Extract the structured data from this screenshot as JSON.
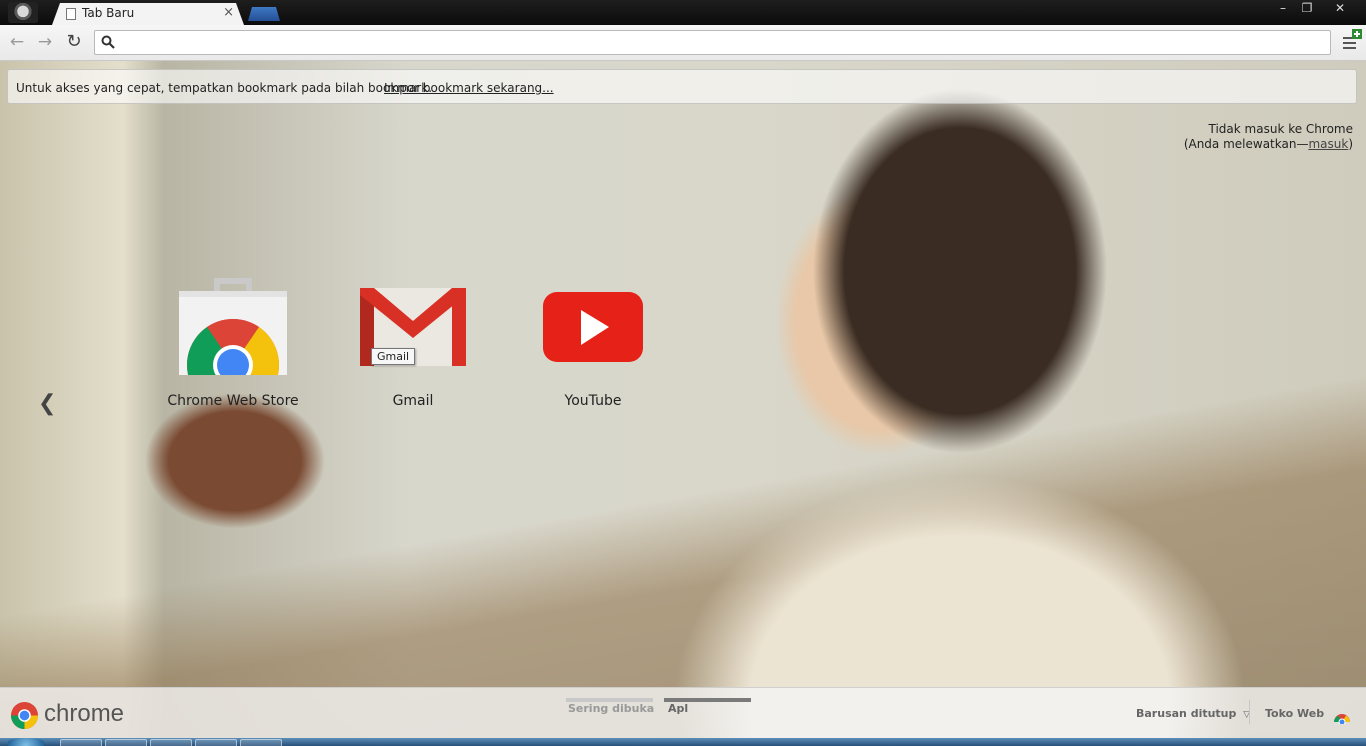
{
  "browser": {
    "tab_title": "Tab Baru",
    "tab_close_glyph": "×",
    "window_controls": {
      "minimize": "–",
      "restore": "❐",
      "close": "✕"
    }
  },
  "toolbar": {
    "back_glyph": "←",
    "forward_glyph": "→",
    "reload_glyph": "↻",
    "omnibox_value": "",
    "icons": [
      "search-icon",
      "menu-icon"
    ]
  },
  "bookmark_bar": {
    "text": "Untuk akses yang cepat, tempatkan bookmark pada bilah bookmark.",
    "import_link": "Impor bookmark sekarang..."
  },
  "signin": {
    "line1": "Tidak masuk ke Chrome",
    "line2_prefix": "(Anda melewatkan—",
    "link": "masuk",
    "line2_suffix": ")"
  },
  "apps": [
    {
      "label": "Chrome Web Store",
      "icon": "chrome-web-store-icon"
    },
    {
      "label": "Gmail",
      "icon": "gmail-icon"
    },
    {
      "label": "YouTube",
      "icon": "youtube-icon"
    }
  ],
  "tooltip": "Gmail",
  "pager_prev_glyph": "❮",
  "footer": {
    "brand": "chrome",
    "pages": [
      "Sering dibuka",
      "Apl"
    ],
    "active_page": "Apl",
    "recently_closed": "Barusan ditutup",
    "recently_closed_arrow": "▽",
    "web_store": "Toko Web"
  },
  "colors": {
    "youtube_red": "#e62117",
    "gmail_red": "#d93025",
    "chrome_red": "#db4437",
    "chrome_yellow": "#f4c20d",
    "chrome_green": "#0f9d58",
    "chrome_blue": "#4285f4"
  }
}
